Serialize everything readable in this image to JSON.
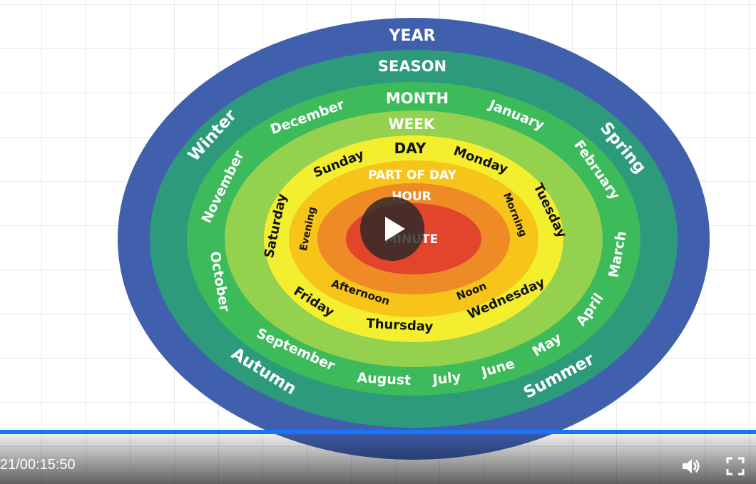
{
  "diagram": {
    "rings": [
      {
        "label": "YEAR",
        "color": "#4060ad"
      },
      {
        "label": "SEASON",
        "color": "#2e9a7c"
      },
      {
        "label": "MONTH",
        "color": "#3dbb5b"
      },
      {
        "label": "WEEK",
        "color": "#93d14e"
      },
      {
        "label": "DAY",
        "color": "#f4ef2e"
      },
      {
        "label": "PART OF DAY",
        "color": "#f7c419"
      },
      {
        "label": "HOUR",
        "color": "#ee8b26"
      },
      {
        "label": "MINUTE",
        "color": "#e2452c"
      }
    ],
    "seasons": [
      "Winter",
      "Spring",
      "Autumn",
      "Summer"
    ],
    "months": [
      "December",
      "January",
      "February",
      "November",
      "March",
      "October",
      "April",
      "September",
      "May",
      "August",
      "July",
      "June"
    ],
    "days": [
      "Sunday",
      "Monday",
      "Tuesday",
      "Saturday",
      "Friday",
      "Thursday",
      "Wednesday"
    ],
    "parts_of_day": [
      "Evening",
      "Morning",
      "Afternoon",
      "Noon"
    ]
  },
  "player": {
    "time_display": "21/00:15:50",
    "progress": 1.0,
    "accent": "#1a73ff",
    "icons": {
      "play": "play-icon",
      "volume": "volume-icon",
      "fullscreen": "fullscreen-icon"
    }
  }
}
